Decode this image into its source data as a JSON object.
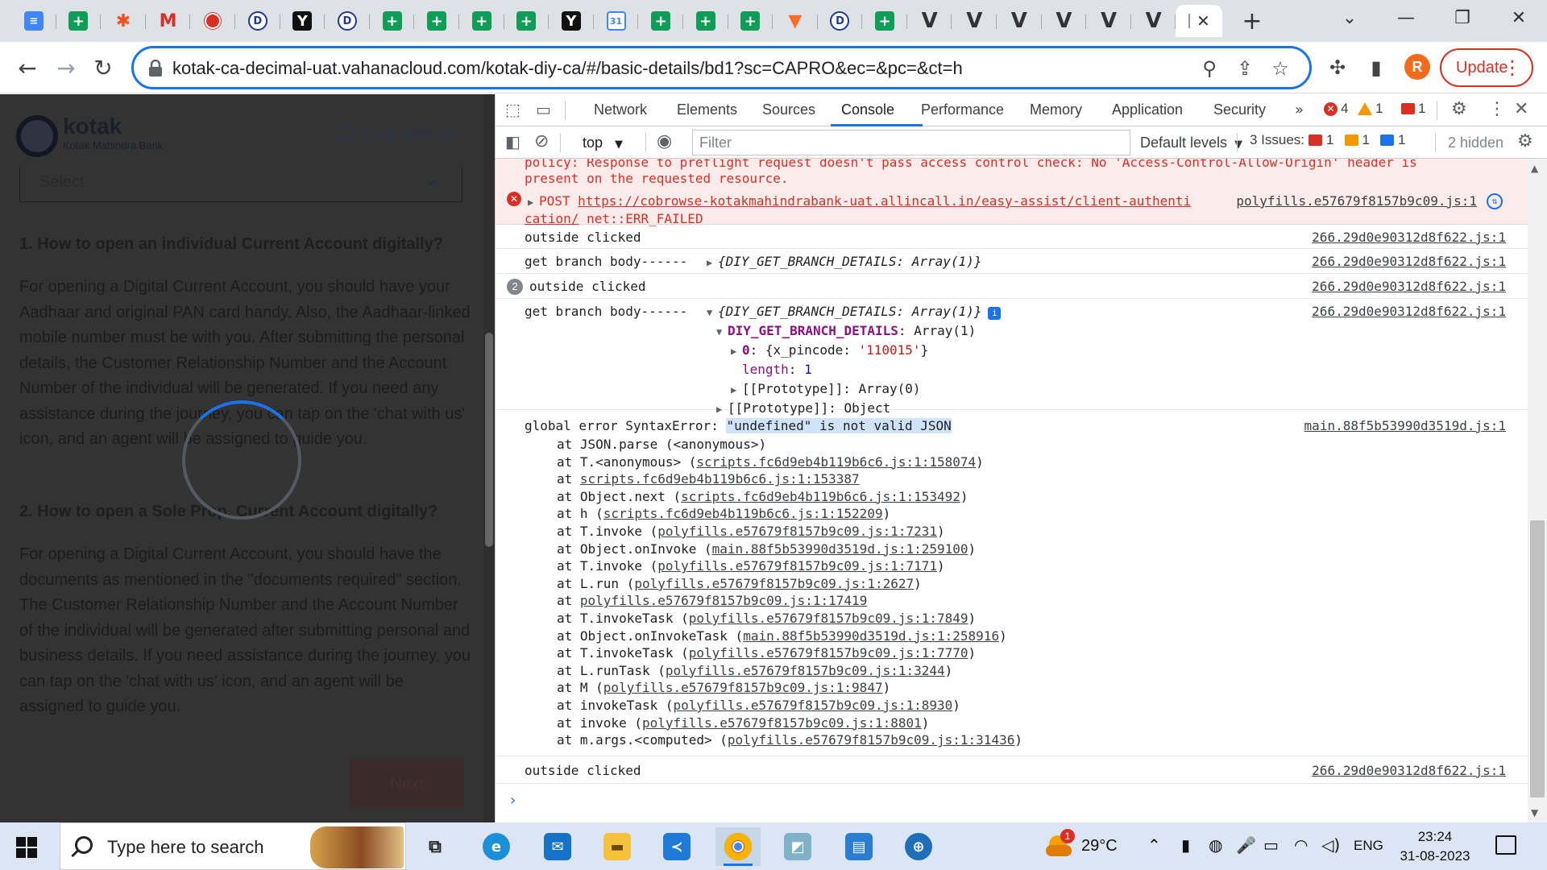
{
  "browser": {
    "tabs": [
      {
        "icon": "google-docs-icon",
        "glyph": "≡"
      },
      {
        "icon": "google-sheets-icon",
        "glyph": "+"
      },
      {
        "icon": "figma-icon",
        "glyph": "✱"
      },
      {
        "icon": "gmail-icon",
        "glyph": "M"
      },
      {
        "icon": "record-icon",
        "glyph": ""
      },
      {
        "icon": "d-app-icon",
        "glyph": "D"
      },
      {
        "icon": "y-app-icon",
        "glyph": "Y"
      },
      {
        "icon": "d-app-icon",
        "glyph": "D"
      },
      {
        "icon": "google-sheets-icon",
        "glyph": "+"
      },
      {
        "icon": "google-sheets-icon",
        "glyph": "+"
      },
      {
        "icon": "google-sheets-icon",
        "glyph": "+"
      },
      {
        "icon": "google-sheets-icon",
        "glyph": "+"
      },
      {
        "icon": "y-app-icon",
        "glyph": "Y"
      },
      {
        "icon": "google-calendar-icon",
        "glyph": "31"
      },
      {
        "icon": "google-sheets-icon",
        "glyph": "+"
      },
      {
        "icon": "google-sheets-icon",
        "glyph": "+"
      },
      {
        "icon": "google-sheets-icon",
        "glyph": "+"
      },
      {
        "icon": "gitlab-icon",
        "glyph": "▼"
      },
      {
        "icon": "d-app-icon",
        "glyph": "D"
      },
      {
        "icon": "google-sheets-icon",
        "glyph": "+"
      },
      {
        "icon": "v-app-icon",
        "glyph": "V"
      },
      {
        "icon": "v-app-icon",
        "glyph": "V"
      },
      {
        "icon": "v-app-icon",
        "glyph": "V"
      },
      {
        "icon": "v-app-icon",
        "glyph": "V"
      },
      {
        "icon": "v-app-icon",
        "glyph": "V"
      },
      {
        "icon": "v-app-icon",
        "glyph": "V"
      }
    ],
    "url": "kotak-ca-decimal-uat.vahanacloud.com/kotak-diy-ca/#/basic-details/bd1?sc=CAPRO&ec=&pc=&ct=h",
    "avatar_letter": "R",
    "update_label": "Update"
  },
  "page": {
    "brand_name": "kotak",
    "brand_sub": "Kotak Mahindra Bank",
    "chat_label": "Chat with us",
    "select_placeholder": "Select",
    "faq": [
      {
        "question": "1. How to open an individual Current Account digitally?",
        "answer": "For opening a Digital Current Account, you should have your Aadhaar and original PAN card handy. Also, the Aadhaar-linked mobile number must be with you. After submitting the personal details, the Customer Relationship Number and the Account Number of the individual will be generated. If you need any assistance during the journey, you can tap on the 'chat with us' icon, and an agent will be assigned to guide you."
      },
      {
        "question": "2. How to open a Sole Prop. Current Account digitally?",
        "answer": "For opening a Digital Current Account, you should have the documents as mentioned in the \"documents required\" section. The Customer Relationship Number and the Account Number of the individual will be generated after submitting personal and business details. If you need assistance during the journey, you can tap on the 'chat with us' icon, and an agent will be assigned to guide you."
      }
    ],
    "next_label": "Next"
  },
  "devtools": {
    "tabs": [
      "Network",
      "Elements",
      "Sources",
      "Console",
      "Performance",
      "Memory",
      "Application",
      "Security"
    ],
    "active_tab": "Console",
    "more_tabs": "»",
    "counts": {
      "errors": "4",
      "warnings": "1",
      "issues": "1"
    },
    "context": "top",
    "filter_placeholder": "Filter",
    "levels": "Default levels",
    "issues_label": "3 Issues:",
    "issue_counts": {
      "error": "1",
      "warning": "1",
      "info": "1"
    },
    "hidden": "2 hidden",
    "console": {
      "cors_line1": "policy: Response to preflight request doesn't pass access control check: No 'Access-Control-Allow-Origin' header is",
      "cors_line2": "present on the requested resource.",
      "post_method": "POST",
      "post_url1": "https://cobrowse-kotakmahindrabank-uat.allincall.in/easy-assist/client-authenti",
      "post_url2": "cation/",
      "post_error": "net::ERR_FAILED",
      "post_src": "polyfills.e57679f8157b9c09.js:1",
      "outside_clicked": "outside clicked",
      "branch_label": "get branch body------",
      "branch_obj": "{DIY_GET_BRANCH_DETAILS: Array(1)}",
      "src_266": "266.29d0e90312d8f622.js:1",
      "repeat_count": "2",
      "arr_key": "DIY_GET_BRANCH_DETAILS",
      "arr_val": "Array(1)",
      "item_key": "0",
      "item_obj_open": "{x_pincode: ",
      "item_pincode": "'110015'",
      "item_obj_close": "}",
      "length_key": "length",
      "length_val": "1",
      "proto_arr": "[[Prototype]]: Array(0)",
      "proto_obj": "[[Prototype]]: Object",
      "global_error_prefix": "global error SyntaxError: ",
      "global_error_hl": "\"undefined\" is not valid JSON",
      "global_error_src": "main.88f5b53990d3519d.js:1",
      "stack": [
        {
          "pre": "at JSON.parse (<anonymous>)",
          "link": "",
          "post": ""
        },
        {
          "pre": "at T.<anonymous> (",
          "link": "scripts.fc6d9eb4b119b6c6.js:1:158074",
          "post": ")"
        },
        {
          "pre": "at ",
          "link": "scripts.fc6d9eb4b119b6c6.js:1:153387",
          "post": ""
        },
        {
          "pre": "at Object.next (",
          "link": "scripts.fc6d9eb4b119b6c6.js:1:153492",
          "post": ")"
        },
        {
          "pre": "at h (",
          "link": "scripts.fc6d9eb4b119b6c6.js:1:152209",
          "post": ")"
        },
        {
          "pre": "at T.invoke (",
          "link": "polyfills.e57679f8157b9c09.js:1:7231",
          "post": ")"
        },
        {
          "pre": "at Object.onInvoke (",
          "link": "main.88f5b53990d3519d.js:1:259100",
          "post": ")"
        },
        {
          "pre": "at T.invoke (",
          "link": "polyfills.e57679f8157b9c09.js:1:7171",
          "post": ")"
        },
        {
          "pre": "at L.run (",
          "link": "polyfills.e57679f8157b9c09.js:1:2627",
          "post": ")"
        },
        {
          "pre": "at ",
          "link": "polyfills.e57679f8157b9c09.js:1:17419",
          "post": ""
        },
        {
          "pre": "at T.invokeTask (",
          "link": "polyfills.e57679f8157b9c09.js:1:7849",
          "post": ")"
        },
        {
          "pre": "at Object.onInvokeTask (",
          "link": "main.88f5b53990d3519d.js:1:258916",
          "post": ")"
        },
        {
          "pre": "at T.invokeTask (",
          "link": "polyfills.e57679f8157b9c09.js:1:7770",
          "post": ")"
        },
        {
          "pre": "at L.runTask (",
          "link": "polyfills.e57679f8157b9c09.js:1:3244",
          "post": ")"
        },
        {
          "pre": "at M (",
          "link": "polyfills.e57679f8157b9c09.js:1:9847",
          "post": ")"
        },
        {
          "pre": "at invokeTask (",
          "link": "polyfills.e57679f8157b9c09.js:1:8930",
          "post": ")"
        },
        {
          "pre": "at invoke (",
          "link": "polyfills.e57679f8157b9c09.js:1:8801",
          "post": ")"
        },
        {
          "pre": "at m.args.<computed> (",
          "link": "polyfills.e57679f8157b9c09.js:1:31436",
          "post": ")"
        }
      ],
      "prompt": "›"
    }
  },
  "taskbar": {
    "search_placeholder": "Type here to search",
    "weather_temp": "29°C",
    "weather_badge": "1",
    "language": "ENG",
    "time": "23:24",
    "date": "31-08-2023"
  }
}
